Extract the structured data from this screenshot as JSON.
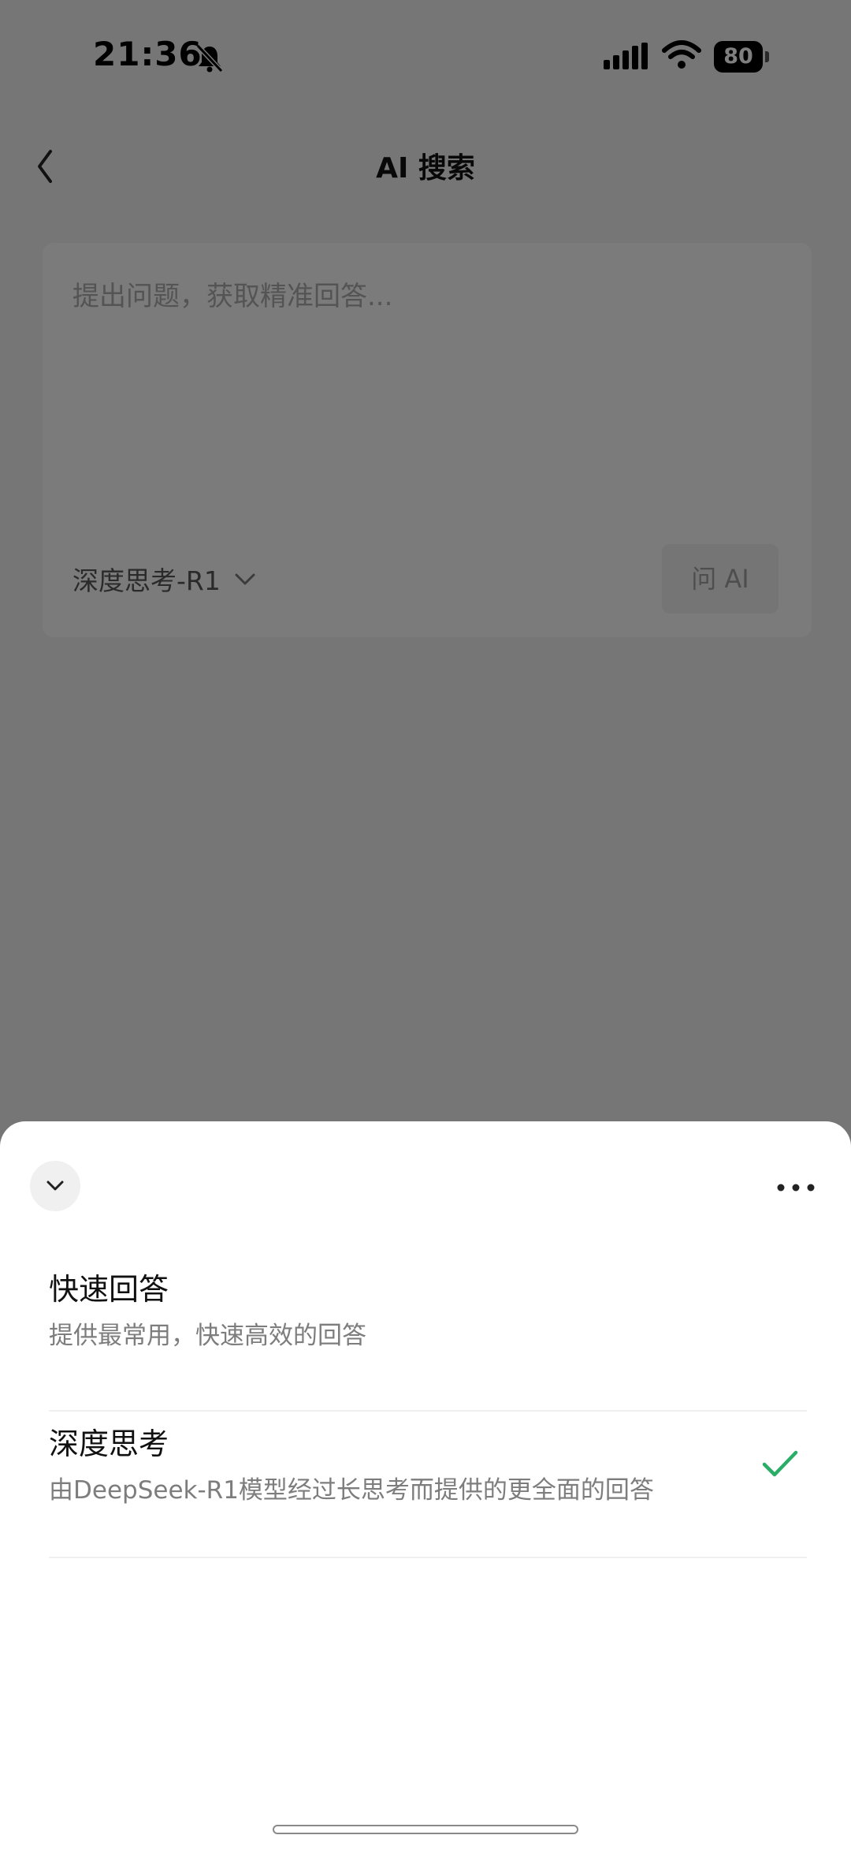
{
  "status_bar": {
    "time": "21:36",
    "battery": "80",
    "icons": [
      "bell-muted-icon",
      "cellular-signal-icon",
      "wifi-icon",
      "battery-icon"
    ]
  },
  "nav": {
    "title": "AI 搜索",
    "back_icon": "chevron-left-icon"
  },
  "search": {
    "placeholder": "提出问题，获取精准回答...",
    "value": "",
    "model_label": "深度思考-R1",
    "model_icon": "chevron-down-icon",
    "ask_button_label": "问 AI"
  },
  "sheet": {
    "collapse_icon": "chevron-down-icon",
    "more_icon": "ellipsis-icon",
    "options": [
      {
        "title": "快速回答",
        "description": "提供最常用，快速高效的回答",
        "selected": false
      },
      {
        "title": "深度思考",
        "description": "由DeepSeek-R1模型经过长思考而提供的更全面的回答",
        "selected": true
      }
    ],
    "check_color": "#2aae67"
  },
  "colors": {
    "page_bg": "#ededed",
    "overlay": "rgba(0,0,0,0.5)",
    "sheet_bg": "#ffffff",
    "accent_green": "#2aae67"
  }
}
